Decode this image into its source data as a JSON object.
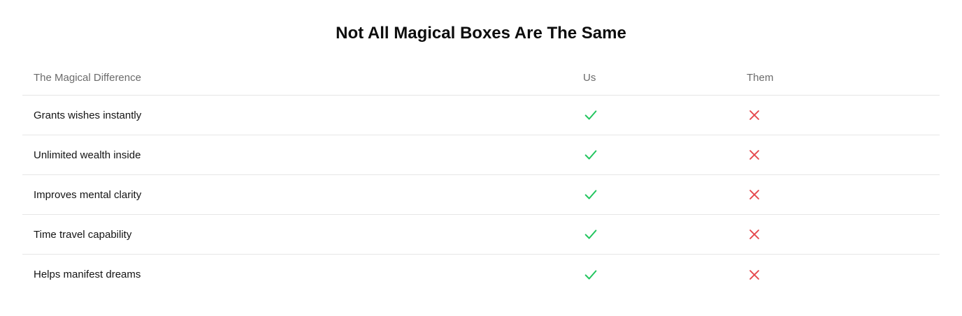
{
  "title": "Not All Magical Boxes Are The Same",
  "table": {
    "headers": {
      "feature": "The Magical Difference",
      "us": "Us",
      "them": "Them"
    },
    "rows": [
      {
        "feature": "Grants wishes instantly",
        "us": "check-icon",
        "them": "x-icon"
      },
      {
        "feature": "Unlimited wealth inside",
        "us": "check-icon",
        "them": "x-icon"
      },
      {
        "feature": "Improves mental clarity",
        "us": "check-icon",
        "them": "x-icon"
      },
      {
        "feature": "Time travel capability",
        "us": "check-icon",
        "them": "x-icon"
      },
      {
        "feature": "Helps manifest dreams",
        "us": "check-icon",
        "them": "x-icon"
      }
    ]
  },
  "colors": {
    "check": "#22c55e",
    "cross": "#e5484d",
    "divider": "#e6e6e6",
    "header_text": "#6b6b6b"
  }
}
